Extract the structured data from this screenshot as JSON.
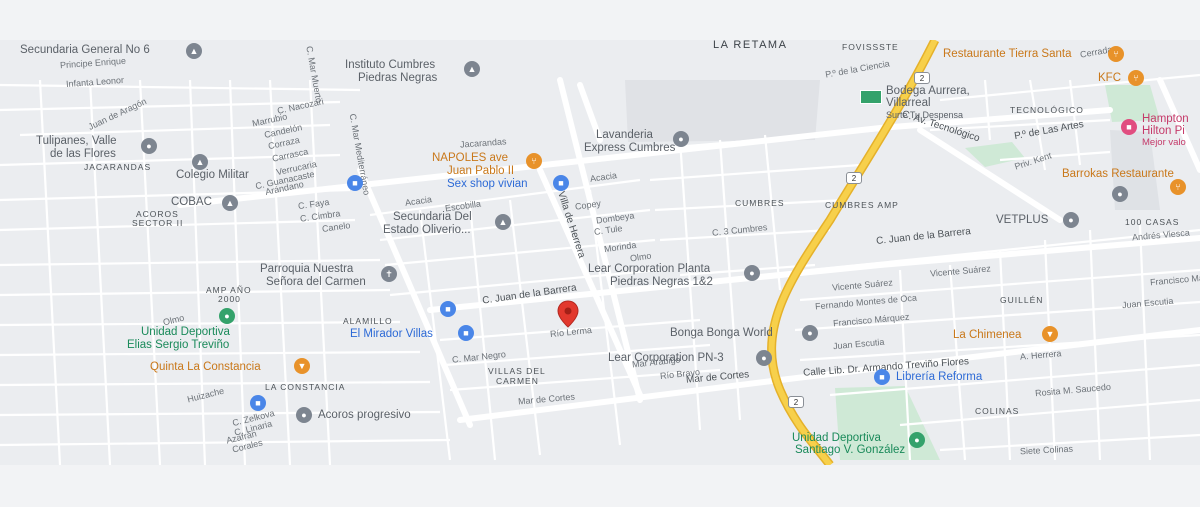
{
  "map": {
    "pois": {
      "secundaria6": "Secundaria General No 6",
      "cumbres_inst_1": "Instituto Cumbres",
      "cumbres_inst_2": "Piedras Negras",
      "tulipanes_1": "Tulipanes, Valle",
      "tulipanes_2": "de las Flores",
      "colegio_militar": "Colegio Militar",
      "cobac": "COBAC",
      "napoles_1": "NAPOLES ave",
      "napoles_2": "Juan Pablo II",
      "sex_shop": "Sex shop vivian",
      "lavanderia_1": "Lavanderia",
      "lavanderia_2": "Express Cumbres",
      "secundaria_estado_1": "Secundaria Del",
      "secundaria_estado_2": "Estado Oliverio...",
      "parroquia_1": "Parroquia Nuestra",
      "parroquia_2": "Señora del Carmen",
      "unidad_elias_1": "Unidad Deportiva",
      "unidad_elias_2": "Elias Sergio Treviño",
      "quinta": "Quinta La Constancia",
      "acoros": "Acoros progresivo",
      "mirador": "El Mirador Villas",
      "lear_planta_1": "Lear Corporation Planta",
      "lear_planta_2": "Piedras Negras 1&2",
      "bonga": "Bonga Bonga World",
      "lear_pn3": "Lear Corporation PN-3",
      "bodega_1": "Bodega Aurrera,",
      "bodega_2": "Villarreal",
      "bodega_3": "Surte Tu Despensa",
      "tierra_santa": "Restaurante Tierra Santa",
      "kfc": "KFC",
      "hampton_1": "Hampton",
      "hampton_2": "Hilton Pi",
      "hampton_3": "Mejor valo",
      "barrokas": "Barrokas Restaurante",
      "vetplus": "VETPLUS",
      "chimenea": "La Chimenea",
      "libreria": "Librería Reforma",
      "unidad_santiago_1": "Unidad Deportiva",
      "unidad_santiago_2": "Santiago V. González"
    },
    "neighborhoods": {
      "la_retama": "LA RETAMA",
      "fovissste": "FOVISSSTE",
      "tecnologico": "TECNOLÓGICO",
      "jacarandas": "JACARANDAS",
      "acoros_sector_1": "ACOROS",
      "acoros_sector_2": "SECTOR II",
      "cumbres": "CUMBRES",
      "cumbres_amp": "CUMBRES AMP",
      "amp_ano_1": "AMP AÑO",
      "amp_ano_2": "2000",
      "alamillo": "ALAMILLO",
      "la_constancia": "LA CONSTANCIA",
      "villas_1": "VILLAS DEL",
      "villas_2": "CARMEN",
      "guillen": "GUILLÉN",
      "colinas": "COLINAS",
      "cien_casas": "100 CASAS"
    },
    "streets": {
      "tecnologico": "C. Av. Tecnológico",
      "juan_barrera_1": "C. Juan de la Barrera",
      "juan_barrera_2": "C. Juan de la Barrera",
      "villa_herrera": "Villa de Herrera",
      "mar_cortes": "Mar de Cortes",
      "mar_cortes_2": "Mar de Cortes",
      "calle_lib": "Calle Lib. Dr. Armando Treviño Flores",
      "artes": "P.º de Las Artes",
      "principe": "Principe Enrique",
      "infanta": "Infanta Leonor",
      "juan_aragon": "Juan de Aragón",
      "mar_muerto": "C. Mar Muerto",
      "mar_mediterraneo": "C. Mar Mediterráneo",
      "nacozari": "C. Nacozari",
      "marrubio": "Marrubio",
      "candelon": "Candelón",
      "corraza": "Corraza",
      "carrasca": "Carrasca",
      "verrucaria": "Verrucaria",
      "arandano": "Arándano",
      "guanacaste": "C. Guanacaste",
      "faya": "C. Faya",
      "cimbra": "C. Cimbra",
      "canelo": "Canelo",
      "acacia": "Acacia",
      "escobilla": "Escobilla",
      "acacia2": "Acacia",
      "copey": "Copey",
      "dombeya": "Dombeya",
      "tule": "C. Tule",
      "morinda": "Morinda",
      "olmo": "Olmo",
      "tres_cumbres": "C. 3 Cumbres",
      "rio_lerma": "Río Lerma",
      "mar_negro": "C. Mar Negro",
      "mar_arabigo": "Mar Arábigo",
      "rio_bravo": "Río Bravo",
      "vicente_suarez": "Vicente Suárez",
      "vicente_suarez2": "Vicente Suárez",
      "fernando_montes": "Fernando Montes de Oca",
      "francisco_marquez": "Francisco Márquez",
      "francisco_marquez2": "Francisco Ma",
      "juan_escutia": "Juan Escutia",
      "juan_escutia2": "Juan Escutia",
      "andres_viesca": "Andrés Viesca",
      "a_herrera": "A. Herrera",
      "rosita": "Rosita M. Saucedo",
      "siete_colinas": "Siete Colinas",
      "zelkova": "C. Zelkova",
      "linaria": "C. Linaria",
      "azafran": "Azafrán",
      "corales": "Corales",
      "huizache": "Huizache",
      "olmo2": "Olmo",
      "jacarandas_st": "Jacarandas",
      "priv_kent": "Priv. Kent",
      "cerrada": "Cerrada",
      "ciencia": "P.º de la Ciencia"
    },
    "highway_shield": "2"
  }
}
